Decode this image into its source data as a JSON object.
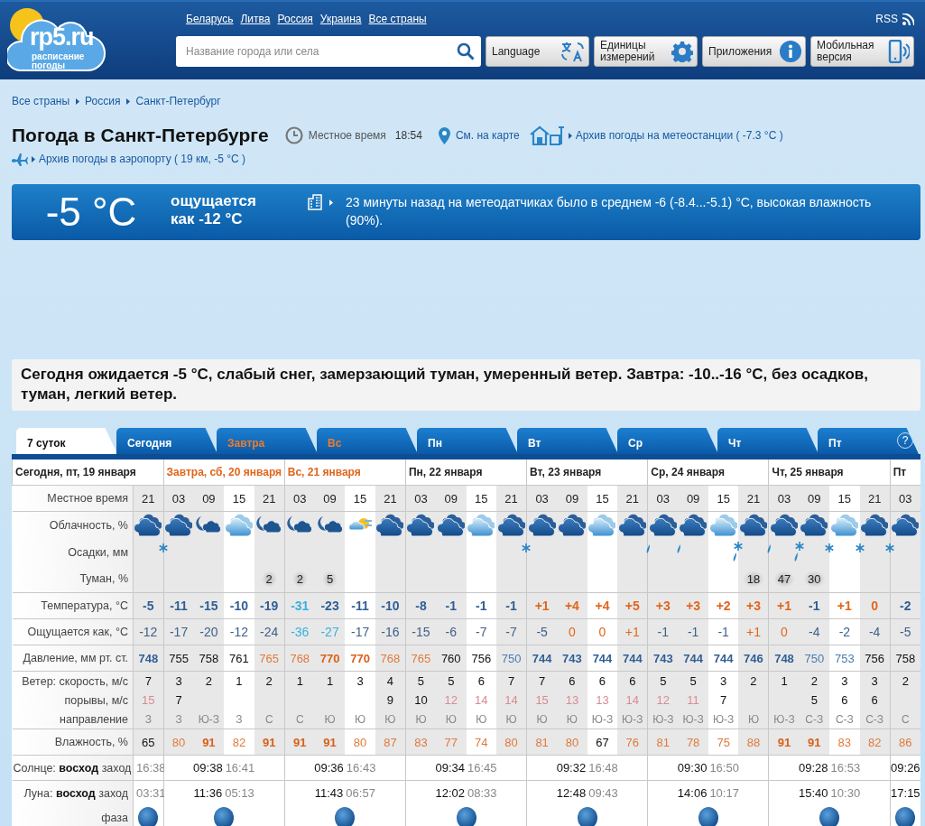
{
  "header": {
    "logo": {
      "name": "rp5.ru",
      "tagline": "расписание погоды"
    },
    "countries": [
      "Беларусь",
      "Литва",
      "Россия",
      "Украина",
      "Все страны"
    ],
    "rss": "RSS",
    "search": {
      "placeholder": "Название города или села"
    },
    "buttons": [
      {
        "label": "Language",
        "kind": "translate"
      },
      {
        "label": "Единицы измерений",
        "kind": "gear"
      },
      {
        "label": "Приложения",
        "kind": "info"
      },
      {
        "label": "Мобильная версия",
        "kind": "phone"
      }
    ]
  },
  "breadcrumb": [
    "Все страны",
    "Россия",
    "Санкт-Петербург"
  ],
  "title": "Погода в Санкт-Петербурге",
  "local_time": {
    "label": "Местное время",
    "value": "18:54"
  },
  "map_link": "См. на карте",
  "station_archive": "Архив погоды на метеостанции ( -7.3 °C )",
  "airport_archive": "Архив погоды в аэропорту ( 19 км, -5 °C )",
  "current": {
    "temperature": "-5 °C",
    "feels_like": "ощущается как -12 °C",
    "observation": "23 минуты назад на метеодатчиках было в среднем -6 (-8.4...-5.1) °C, высокая влажность (90%)."
  },
  "summary": "Сегодня ожидается -5 °C, слабый снег, замерзающий туман, умеренный ветер. Завтра: -10..-16 °C, без осадков, туман, легкий ветер.",
  "tabs": [
    {
      "label": "7 суток",
      "selected": true,
      "weekend": false
    },
    {
      "label": "Сегодня",
      "selected": false,
      "weekend": false
    },
    {
      "label": "Завтра",
      "selected": false,
      "weekend": true
    },
    {
      "label": "Вс",
      "selected": false,
      "weekend": true
    },
    {
      "label": "Пн",
      "selected": false,
      "weekend": false
    },
    {
      "label": "Вт",
      "selected": false,
      "weekend": false
    },
    {
      "label": "Ср",
      "selected": false,
      "weekend": false
    },
    {
      "label": "Чт",
      "selected": false,
      "weekend": false
    },
    {
      "label": "Пт",
      "selected": false,
      "weekend": false
    }
  ],
  "help": "?",
  "forecast": {
    "labels": {
      "time": "Местное время",
      "sky": "Облачность, %",
      "precip": "Осадки, мм",
      "fog": "Туман, %",
      "temp": "Температура, °С",
      "feels": "Ощущается как, °С",
      "pressure": "Давление, мм рт. ст.",
      "wind": "Ветер: скорость, м/с",
      "gusts": "порывы, м/с",
      "dir": "направление",
      "humidity": "Влажность, %",
      "sun": "Солнце: **восход** заход",
      "moon": "Луна: **восход** заход",
      "phase": "фаза"
    },
    "days": [
      {
        "label": "Сегодня, пт, 19 января",
        "weekend": false,
        "sun": {
          "set": "16:38"
        },
        "moon": {
          "set": "03:31"
        },
        "slots": [
          {
            "time": "21",
            "daytime": false,
            "sky": {
              "kind": "overcast"
            },
            "precip": {
              "kind": "snow"
            },
            "temp": "-5",
            "feels": "-12",
            "pressure": {
              "text": "748",
              "color": "#2f5f96",
              "bold": true
            },
            "wind": "7",
            "gusts": {
              "text": "15",
              "color": "#d98a94"
            },
            "dir": "З",
            "humidity": "65"
          }
        ]
      },
      {
        "label": "Завтра, сб, 20 января",
        "weekend": true,
        "sun": {
          "rise": "09:38",
          "set": "16:41"
        },
        "moon": {
          "rise": "11:36",
          "set": "05:13"
        },
        "slots": [
          {
            "time": "03",
            "daytime": false,
            "sky": {
              "kind": "overcast"
            },
            "temp": "-11",
            "feels": "-17",
            "pressure": "755",
            "wind": "3",
            "gusts": "7",
            "dir": "З",
            "humidity": {
              "text": "80",
              "color": "#e07a3c"
            }
          },
          {
            "time": "09",
            "daytime": false,
            "sky": {
              "kind": "night"
            },
            "temp": "-15",
            "feels": "-20",
            "pressure": "758",
            "wind": "2",
            "dir": "Ю-З",
            "humidity": {
              "text": "91",
              "color": "#d9601a",
              "bold": true
            }
          },
          {
            "time": "15",
            "daytime": true,
            "sky": {
              "kind": "light"
            },
            "temp": "-10",
            "feels": "-12",
            "pressure": "761",
            "wind": "1",
            "dir": "З",
            "humidity": {
              "text": "82",
              "color": "#e07a3c"
            }
          },
          {
            "time": "21",
            "daytime": false,
            "sky": {
              "kind": "night"
            },
            "fog": "2",
            "temp": "-19",
            "feels": "-24",
            "pressure": {
              "text": "765",
              "color": "#e07a3c"
            },
            "wind": "2",
            "dir": "С",
            "humidity": {
              "text": "91",
              "color": "#d9601a",
              "bold": true
            }
          }
        ]
      },
      {
        "label": "Вс, 21 января",
        "weekend": true,
        "sun": {
          "rise": "09:36",
          "set": "16:43"
        },
        "moon": {
          "rise": "11:43",
          "set": "06:57"
        },
        "slots": [
          {
            "time": "03",
            "daytime": false,
            "sky": {
              "kind": "night"
            },
            "fog": "2",
            "temp": {
              "text": "-31",
              "color": "#38b0e0"
            },
            "feels": {
              "text": "-36",
              "color": "#38b0e0"
            },
            "pressure": {
              "text": "768",
              "color": "#e07a3c"
            },
            "wind": "1",
            "dir": "С",
            "humidity": {
              "text": "91",
              "color": "#d9601a",
              "bold": true
            }
          },
          {
            "time": "09",
            "daytime": false,
            "sky": {
              "kind": "night"
            },
            "fog": "5",
            "temp": "-23",
            "feels": {
              "text": "-27",
              "color": "#38b0e0"
            },
            "pressure": {
              "text": "770",
              "color": "#d9601a",
              "bold": true
            },
            "wind": "1",
            "dir": "Ю",
            "humidity": {
              "text": "91",
              "color": "#d9601a",
              "bold": true
            }
          },
          {
            "time": "15",
            "daytime": true,
            "sky": {
              "kind": "sun"
            },
            "temp": "-11",
            "feels": "-17",
            "pressure": {
              "text": "770",
              "color": "#d9601a",
              "bold": true
            },
            "wind": "3",
            "dir": "Ю",
            "humidity": {
              "text": "80",
              "color": "#e07a3c"
            }
          },
          {
            "time": "21",
            "daytime": false,
            "sky": {
              "kind": "overcast"
            },
            "temp": "-10",
            "feels": "-16",
            "pressure": {
              "text": "768",
              "color": "#e07a3c"
            },
            "wind": "4",
            "gusts": "9",
            "dir": "Ю",
            "humidity": {
              "text": "87",
              "color": "#e07a3c"
            }
          }
        ]
      },
      {
        "label": "Пн, 22 января",
        "weekend": false,
        "sun": {
          "rise": "09:34",
          "set": "16:45"
        },
        "moon": {
          "rise": "12:02",
          "set": "08:33"
        },
        "slots": [
          {
            "time": "03",
            "daytime": false,
            "sky": {
              "kind": "overcast"
            },
            "temp": "-8",
            "feels": "-15",
            "pressure": {
              "text": "765",
              "color": "#e07a3c"
            },
            "wind": "5",
            "gusts": "10",
            "dir": "Ю",
            "humidity": {
              "text": "83",
              "color": "#e07a3c"
            }
          },
          {
            "time": "09",
            "daytime": false,
            "sky": {
              "kind": "overcast"
            },
            "temp": "-1",
            "feels": "-6",
            "pressure": "760",
            "wind": "5",
            "gusts": {
              "text": "12",
              "color": "#d98a94"
            },
            "dir": "Ю",
            "humidity": {
              "text": "77",
              "color": "#e07a3c"
            }
          },
          {
            "time": "15",
            "daytime": true,
            "sky": {
              "kind": "light"
            },
            "temp": "-1",
            "feels": "-7",
            "pressure": "756",
            "wind": "6",
            "gusts": {
              "text": "14",
              "color": "#d98a94"
            },
            "dir": "Ю",
            "humidity": {
              "text": "74",
              "color": "#e07a3c"
            }
          },
          {
            "time": "21",
            "daytime": false,
            "sky": {
              "kind": "overcast"
            },
            "precip": {
              "kind": "snow"
            },
            "temp": "-1",
            "feels": "-7",
            "pressure": {
              "text": "750",
              "color": "#4a7bb0"
            },
            "wind": "7",
            "gusts": {
              "text": "14",
              "color": "#d98a94"
            },
            "dir": "Ю",
            "humidity": {
              "text": "80",
              "color": "#e07a3c"
            }
          }
        ]
      },
      {
        "label": "Вт, 23 января",
        "weekend": false,
        "sun": {
          "rise": "09:32",
          "set": "16:48"
        },
        "moon": {
          "rise": "12:48",
          "set": "09:43"
        },
        "slots": [
          {
            "time": "03",
            "daytime": false,
            "sky": {
              "kind": "overcast"
            },
            "temp": {
              "text": "+1",
              "color": "#e2661c"
            },
            "feels": "-5",
            "pressure": {
              "text": "744",
              "color": "#2f5f96",
              "bold": true
            },
            "wind": "7",
            "gusts": {
              "text": "15",
              "color": "#d98a94"
            },
            "dir": "Ю",
            "humidity": {
              "text": "81",
              "color": "#e07a3c"
            }
          },
          {
            "time": "09",
            "daytime": false,
            "sky": {
              "kind": "overcast"
            },
            "temp": {
              "text": "+4",
              "color": "#e2661c"
            },
            "feels": {
              "text": "0",
              "color": "#e2661c"
            },
            "pressure": {
              "text": "743",
              "color": "#2f5f96",
              "bold": true
            },
            "wind": "6",
            "gusts": {
              "text": "13",
              "color": "#d98a94"
            },
            "dir": "Ю",
            "humidity": {
              "text": "80",
              "color": "#e07a3c"
            }
          },
          {
            "time": "15",
            "daytime": true,
            "sky": {
              "kind": "light"
            },
            "temp": {
              "text": "+4",
              "color": "#e2661c"
            },
            "feels": {
              "text": "0",
              "color": "#e2661c"
            },
            "pressure": {
              "text": "744",
              "color": "#2f5f96",
              "bold": true
            },
            "wind": "6",
            "gusts": {
              "text": "13",
              "color": "#d98a94"
            },
            "dir": "Ю-З",
            "humidity": "67"
          },
          {
            "time": "21",
            "daytime": false,
            "sky": {
              "kind": "overcast"
            },
            "precip": {
              "kind": "rain"
            },
            "temp": {
              "text": "+5",
              "color": "#e2661c"
            },
            "feels": {
              "text": "+1",
              "color": "#e2661c"
            },
            "pressure": {
              "text": "744",
              "color": "#2f5f96",
              "bold": true
            },
            "wind": "6",
            "gusts": {
              "text": "14",
              "color": "#d98a94"
            },
            "dir": "Ю-З",
            "humidity": {
              "text": "76",
              "color": "#e07a3c"
            }
          }
        ]
      },
      {
        "label": "Ср, 24 января",
        "weekend": false,
        "sun": {
          "rise": "09:30",
          "set": "16:50"
        },
        "moon": {
          "rise": "14:06",
          "set": "10:17"
        },
        "slots": [
          {
            "time": "03",
            "daytime": false,
            "sky": {
              "kind": "overcast"
            },
            "precip": {
              "kind": "rain"
            },
            "temp": {
              "text": "+3",
              "color": "#e2661c"
            },
            "feels": "-1",
            "pressure": {
              "text": "743",
              "color": "#2f5f96",
              "bold": true
            },
            "wind": "5",
            "gusts": {
              "text": "12",
              "color": "#d98a94"
            },
            "dir": "Ю-З",
            "humidity": {
              "text": "81",
              "color": "#e07a3c"
            }
          },
          {
            "time": "09",
            "daytime": false,
            "sky": {
              "kind": "overcast"
            },
            "temp": {
              "text": "+3",
              "color": "#e2661c"
            },
            "feels": "-1",
            "pressure": {
              "text": "744",
              "color": "#2f5f96",
              "bold": true
            },
            "wind": "5",
            "gusts": {
              "text": "11",
              "color": "#d98a94"
            },
            "dir": "Ю-З",
            "humidity": {
              "text": "78",
              "color": "#e07a3c"
            }
          },
          {
            "time": "15",
            "daytime": true,
            "sky": {
              "kind": "light"
            },
            "precip": {
              "kind": "sleet"
            },
            "temp": {
              "text": "+2",
              "color": "#e2661c"
            },
            "feels": "-1",
            "pressure": {
              "text": "744",
              "color": "#2f5f96",
              "bold": true
            },
            "wind": "3",
            "gusts": "7",
            "dir": "Ю-З",
            "humidity": {
              "text": "75",
              "color": "#e07a3c"
            }
          },
          {
            "time": "21",
            "daytime": false,
            "sky": {
              "kind": "overcast"
            },
            "precip": {
              "kind": "rain"
            },
            "fog": "18",
            "temp": {
              "text": "+3",
              "color": "#e2661c"
            },
            "feels": {
              "text": "+1",
              "color": "#e2661c"
            },
            "pressure": {
              "text": "746",
              "color": "#2f5f96",
              "bold": true
            },
            "wind": "2",
            "dir": "Ю",
            "humidity": {
              "text": "88",
              "color": "#e07a3c"
            }
          }
        ]
      },
      {
        "label": "Чт, 25 января",
        "weekend": false,
        "sun": {
          "rise": "09:28",
          "set": "16:53"
        },
        "moon": {
          "rise": "15:40",
          "set": "10:30"
        },
        "slots": [
          {
            "time": "03",
            "daytime": false,
            "sky": {
              "kind": "overcast"
            },
            "precip": {
              "kind": "sleet"
            },
            "fog": "47",
            "temp": {
              "text": "+1",
              "color": "#e2661c"
            },
            "feels": {
              "text": "0",
              "color": "#e2661c"
            },
            "pressure": {
              "text": "748",
              "color": "#2f5f96",
              "bold": true
            },
            "wind": "1",
            "dir": "Ю-З",
            "humidity": {
              "text": "91",
              "color": "#d9601a",
              "bold": true
            }
          },
          {
            "time": "09",
            "daytime": false,
            "sky": {
              "kind": "overcast"
            },
            "precip": {
              "kind": "snow"
            },
            "fog": "30",
            "temp": "-1",
            "feels": "-4",
            "pressure": {
              "text": "750",
              "color": "#4a7bb0"
            },
            "wind": "2",
            "gusts": "5",
            "dir": "С-З",
            "humidity": {
              "text": "91",
              "color": "#d9601a",
              "bold": true
            }
          },
          {
            "time": "15",
            "daytime": true,
            "sky": {
              "kind": "light"
            },
            "precip": {
              "kind": "snow"
            },
            "temp": {
              "text": "+1",
              "color": "#e2661c"
            },
            "feels": "-2",
            "pressure": {
              "text": "753",
              "color": "#4a7bb0"
            },
            "wind": "3",
            "gusts": "6",
            "dir": "С-З",
            "humidity": {
              "text": "83",
              "color": "#e07a3c"
            }
          },
          {
            "time": "21",
            "daytime": false,
            "sky": {
              "kind": "overcast"
            },
            "precip": {
              "kind": "snow"
            },
            "temp": {
              "text": "0",
              "color": "#e2661c"
            },
            "feels": "-4",
            "pressure": "756",
            "wind": "3",
            "gusts": "6",
            "dir": "С-З",
            "humidity": {
              "text": "82",
              "color": "#e07a3c"
            }
          }
        ]
      },
      {
        "label": "Пт",
        "weekend": false,
        "sun": {
          "rise": "09:26"
        },
        "moon": {
          "rise": "17:15"
        },
        "slots": [
          {
            "time": "03",
            "daytime": false,
            "sky": {
              "kind": "overcast"
            },
            "temp": "-2",
            "feels": "-5",
            "pressure": "758",
            "wind": "2",
            "dir": "С",
            "humidity": {
              "text": "86",
              "color": "#e07a3c"
            }
          }
        ]
      }
    ]
  }
}
